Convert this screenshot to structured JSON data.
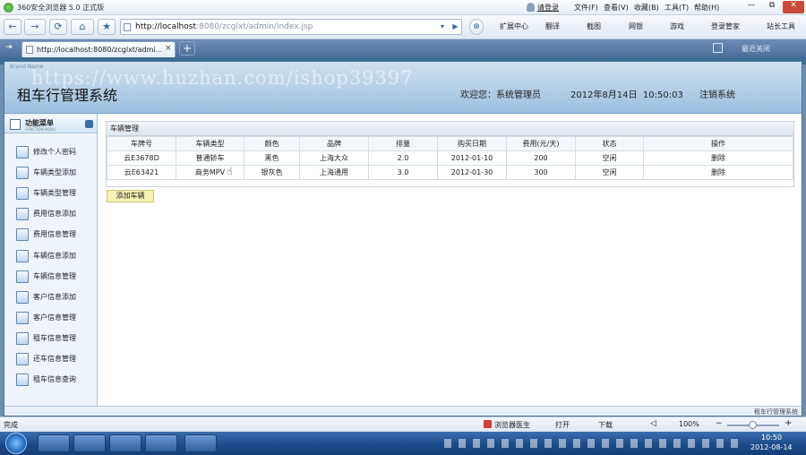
{
  "browser": {
    "title": "360安全浏览器 5.0 正式版",
    "user": "请登录",
    "menus": [
      "文件(F)",
      "查看(V)",
      "收藏(B)",
      "工具(T)",
      "帮助(H)"
    ],
    "window_buttons": [
      "—",
      "⧉",
      "✕"
    ],
    "nav": {
      "back": "←",
      "forward": "→",
      "refresh": "⟳",
      "home": "⌂",
      "favorite": "★"
    },
    "address_host": "http://localhost",
    "address_rest": ":8080/zcglxt/admin/index.jsp",
    "toolbar_items": [
      "扩展中心",
      "翻译",
      "截图",
      "网银",
      "游戏",
      "登录管家",
      "站长工具"
    ],
    "tab_title": "http://localhost:8080/zcglxt/admi...",
    "tab_close": "×",
    "new_tab": "+",
    "closed_tabs": "最近关闭",
    "status_left": "完成",
    "status_items": [
      "浏览器医生",
      "打开",
      "下载"
    ],
    "zoom": "100%",
    "zoom_minus": "−",
    "zoom_plus": "+"
  },
  "app": {
    "watermark": "https://www.huzhan.com/ishop39397",
    "logo": "Brand Name",
    "title": "租车行管理系统",
    "welcome": "欢迎您：系统管理员",
    "datetime": "2012年8月14日  10:50:03",
    "logout": "注销系统",
    "sidebar_title": "功能菜单",
    "sidebar_sub": "FUNCTION MENU",
    "menu": [
      "修改个人密码",
      "车辆类型添加",
      "车辆类型管理",
      "费用信息添加",
      "费用信息管理",
      "车辆信息添加",
      "车辆信息管理",
      "客户信息添加",
      "客户信息管理",
      "租车信息管理",
      "还车信息管理",
      "租车信息查询"
    ],
    "panel_title": "车辆管理",
    "columns": [
      "车牌号",
      "车辆类型",
      "颜色",
      "品牌",
      "排量",
      "购买日期",
      "费用(元/天)",
      "状态",
      "操作"
    ],
    "rows": [
      [
        "云E3678D",
        "普通轿车",
        "黑色",
        "上海大众",
        "2.0",
        "2012-01-10",
        "200",
        "空闲",
        "删除"
      ],
      [
        "云E63421",
        "商务MPV",
        "银灰色",
        "上海通用",
        "3.0",
        "2012-01-30",
        "300",
        "空闲",
        "删除"
      ]
    ],
    "add_button": "添加车辆",
    "footer": "租车行管理系统"
  },
  "taskbar": {
    "clock_time": "10:50",
    "clock_date": "2012-08-14"
  }
}
